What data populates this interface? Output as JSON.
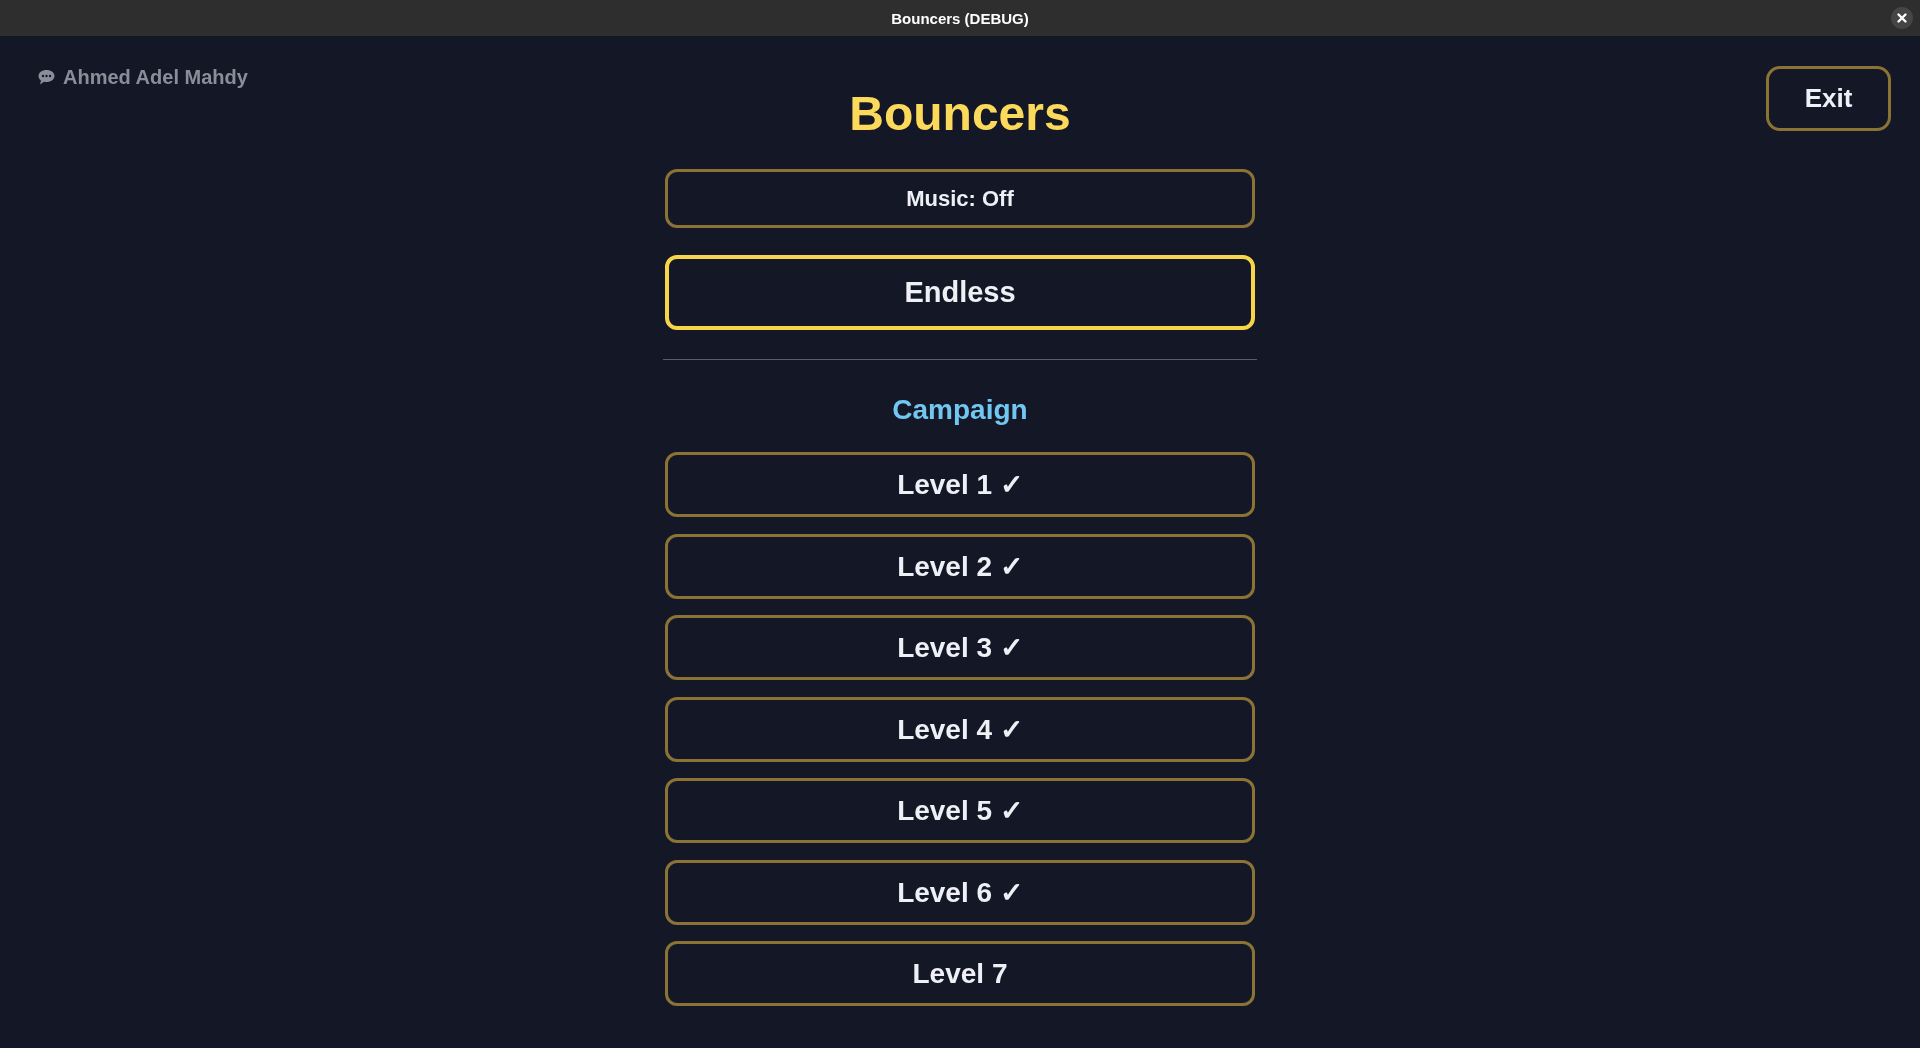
{
  "window": {
    "title": "Bouncers (DEBUG)"
  },
  "author": {
    "name": "Ahmed Adel Mahdy"
  },
  "exit_button": {
    "label": "Exit"
  },
  "game_title": "Bouncers",
  "menu": [
    {
      "kind": "option",
      "label": "Music: Off",
      "selected": false
    },
    {
      "kind": "mode",
      "label": "Endless",
      "selected": true
    }
  ],
  "campaign": {
    "heading": "Campaign",
    "levels": [
      {
        "label": "Level 1 ✓",
        "selected": false
      },
      {
        "label": "Level 2 ✓",
        "selected": false
      },
      {
        "label": "Level 3 ✓",
        "selected": false
      },
      {
        "label": "Level 4 ✓",
        "selected": false
      },
      {
        "label": "Level 5 ✓",
        "selected": false
      },
      {
        "label": "Level 6 ✓",
        "selected": false
      },
      {
        "label": "Level 7",
        "selected": false
      }
    ]
  }
}
